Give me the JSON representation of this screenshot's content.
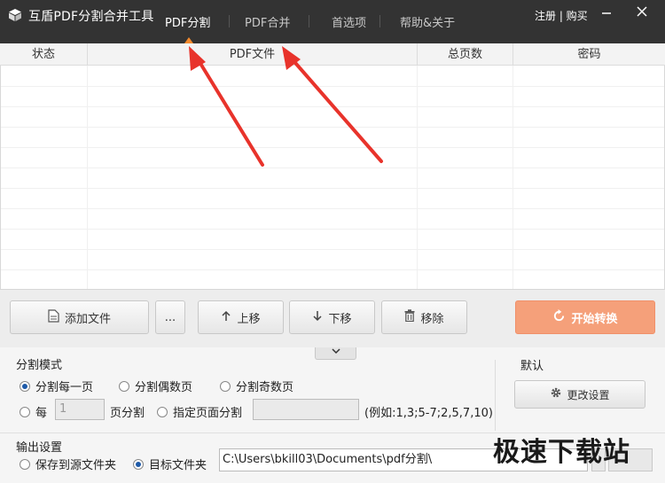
{
  "app": {
    "title": "互盾PDF分割合并工具",
    "tabs": [
      "PDF分割",
      "PDF合并",
      "首选项",
      "帮助&关于"
    ],
    "register_buy": "注册 | 购买",
    "accent_color": "#f28a2e"
  },
  "table": {
    "headers": [
      "状态",
      "PDF文件",
      "总页数",
      "密码"
    ],
    "rows": []
  },
  "toolbar": {
    "add_file": "添加文件",
    "more": "...",
    "move_up": "上移",
    "move_down": "下移",
    "remove": "移除",
    "start": "开始转换"
  },
  "split": {
    "section_title": "分割模式",
    "options": [
      "分割每一页",
      "分割偶数页",
      "分割奇数页"
    ],
    "selected": "分割每一页",
    "every_label": "每",
    "every_value": "",
    "every_placeholder": "1",
    "every_suffix": "页分割",
    "specified_label": "指定页面分割",
    "specified_value": "",
    "example": "(例如:1,3;5-7;2,5,7,10)"
  },
  "defaults": {
    "title": "默认",
    "change_settings": "更改设置"
  },
  "output": {
    "section_title": "输出设置",
    "save_to_source": "保存到源文件夹",
    "target_folder": "目标文件夹",
    "selected": "目标文件夹",
    "path": "C:\\Users\\bkill03\\Documents\\pdf分割\\"
  },
  "watermark": "极速下载站",
  "annotation_color": "#e8332b"
}
